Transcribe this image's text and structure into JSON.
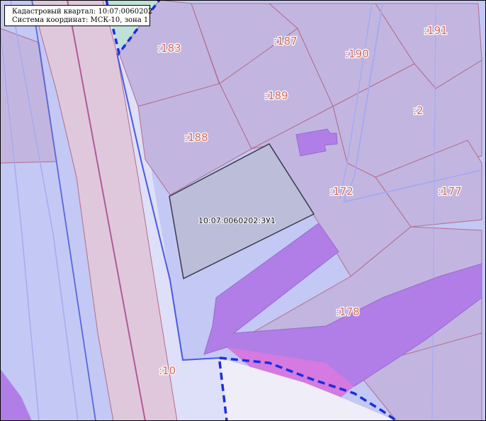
{
  "info_box": {
    "line1": "Кадастровый квартал: 10:07:0060202",
    "line2": "Система координат: МСК-10, зона 1"
  },
  "parcels": {
    "p183": ":183",
    "p187": ":187",
    "p190": ":190",
    "p191": ":191",
    "p189": ":189",
    "p2": ":2",
    "p188": ":188",
    "p172": ":172",
    "p177": ":177",
    "p178": ":178",
    "p10": ":10"
  },
  "main_parcel": {
    "label": "10:07:0060202:ЗУ1"
  },
  "colors": {
    "background": "#c3c8f5",
    "parcel_fill": "#c2b6e0",
    "parcel_border": "#b46b8a",
    "road_fill": "#e0c8dc",
    "road_border": "#7a6aa8",
    "highlight_purple": "#b07ee6",
    "highlight_magenta": "#d47ae0",
    "main_parcel_fill": "#bcbdd9",
    "main_parcel_border": "#3a3a4a",
    "quarter_boundary": "#1a2ee0",
    "label_color": "#d06a5a",
    "corridor_fill": "#e3e3fa",
    "teal_area": "#bfe0d8"
  }
}
